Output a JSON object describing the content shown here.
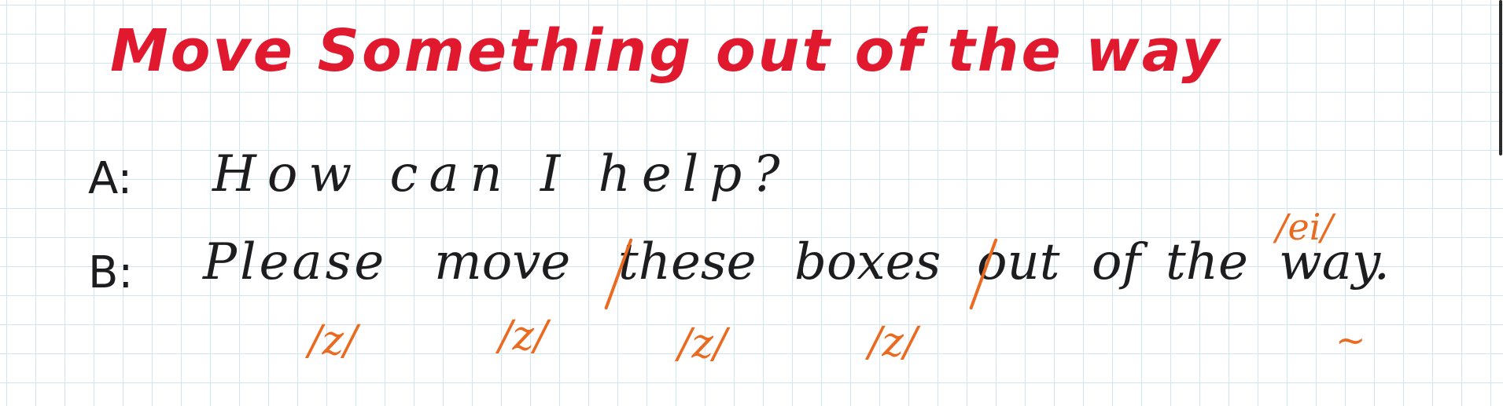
{
  "title": "Move Something out of the way",
  "line_a": {
    "speaker": "A:",
    "text": "How can I help?"
  },
  "line_b": {
    "speaker": "B:",
    "words": {
      "please": "Please",
      "move": "move",
      "these": "these",
      "boxes": "boxes",
      "out": "out",
      "of": "of",
      "the": "the",
      "way": "way."
    }
  },
  "annotations": {
    "z1": "/z/",
    "z2": "/z/",
    "z3": "/z/",
    "z4": "/z/",
    "ei": "/ei/",
    "tilde": "~"
  },
  "colors": {
    "title": "#e0192f",
    "ink": "#1d1d1f",
    "annotation": "#ea6a1f",
    "grid": "#cfe6f2"
  }
}
